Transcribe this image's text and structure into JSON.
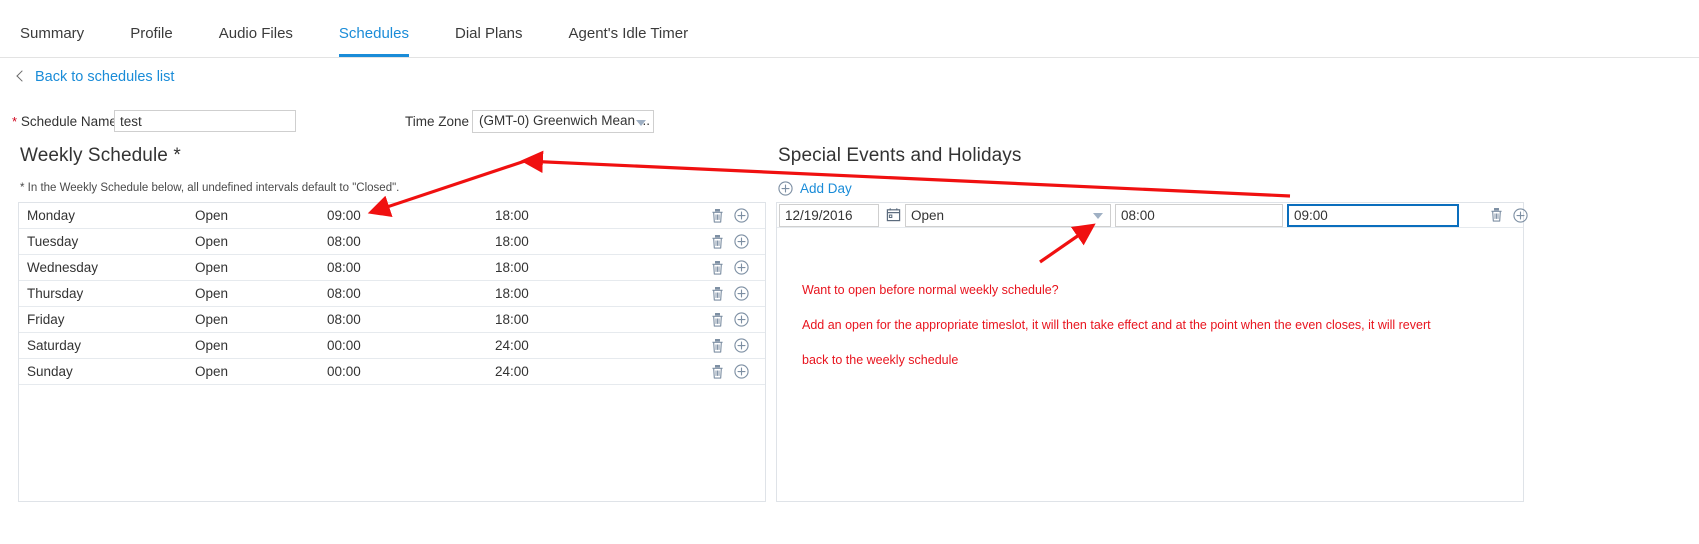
{
  "tabs": [
    {
      "label": "Summary",
      "active": false
    },
    {
      "label": "Profile",
      "active": false
    },
    {
      "label": "Audio Files",
      "active": false
    },
    {
      "label": "Schedules",
      "active": true
    },
    {
      "label": "Dial Plans",
      "active": false
    },
    {
      "label": "Agent's Idle Timer",
      "active": false
    }
  ],
  "back_link": {
    "label": "Back to schedules list",
    "icon": "chevron-left-icon"
  },
  "form": {
    "schedule_name_label": "Schedule Name",
    "schedule_name_value": "test",
    "schedule_name_placeholder": "",
    "required_marker": "*",
    "timezone_label": "Time Zone",
    "timezone_value": "(GMT-0) Greenwich Mean ..."
  },
  "weekly": {
    "title": "Weekly Schedule *",
    "note": "* In the Weekly Schedule below, all undefined intervals default to \"Closed\".",
    "rows": [
      {
        "day": "Monday",
        "state": "Open",
        "from": "09:00",
        "to": "18:00"
      },
      {
        "day": "Tuesday",
        "state": "Open",
        "from": "08:00",
        "to": "18:00"
      },
      {
        "day": "Wednesday",
        "state": "Open",
        "from": "08:00",
        "to": "18:00"
      },
      {
        "day": "Thursday",
        "state": "Open",
        "from": "08:00",
        "to": "18:00"
      },
      {
        "day": "Friday",
        "state": "Open",
        "from": "08:00",
        "to": "18:00"
      },
      {
        "day": "Saturday",
        "state": "Open",
        "from": "00:00",
        "to": "24:00"
      },
      {
        "day": "Sunday",
        "state": "Open",
        "from": "00:00",
        "to": "24:00"
      }
    ]
  },
  "special": {
    "title": "Special Events and Holidays",
    "add_day_label": "Add Day",
    "rows": [
      {
        "date": "12/19/2016",
        "state": "Open",
        "from": "08:00",
        "to": "09:00",
        "to_focused": true
      }
    ]
  },
  "annotation": {
    "line1": "Want to open before normal weekly schedule?",
    "line2": "Add an open for the appropriate timeslot, it will then take effect and at the point when the even closes, it will revert",
    "line3": "back to the weekly schedule"
  },
  "colors": {
    "accent_blue": "#1a8cd8",
    "annotation_red": "#e8141e",
    "icon_gray": "#7d8fa3",
    "focus_blue": "#0a6ebd"
  }
}
